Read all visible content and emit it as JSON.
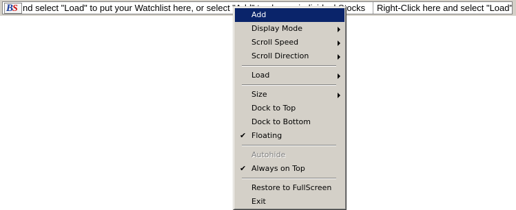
{
  "ticker": {
    "logo": {
      "b": "B",
      "s": "S"
    },
    "scroll_text": "nd select \"Load\" to put your Watchlist here, or select \"Add\" to choose individual Stocks",
    "scroll_text_2": "Right-Click here and select \"Load\" "
  },
  "menu": {
    "items": [
      {
        "label": "Add",
        "highlighted": true
      },
      {
        "label": "Display Mode",
        "submenu": true
      },
      {
        "label": "Scroll Speed",
        "submenu": true
      },
      {
        "label": "Scroll Direction",
        "submenu": true
      },
      {
        "label": "Load",
        "submenu": true
      },
      {
        "label": "Size",
        "submenu": true
      },
      {
        "label": "Dock to Top"
      },
      {
        "label": "Dock to Bottom"
      },
      {
        "label": "Floating",
        "checked": true
      },
      {
        "label": "Autohide",
        "disabled": true
      },
      {
        "label": "Always on Top",
        "checked": true
      },
      {
        "label": "Restore to FullScreen"
      },
      {
        "label": "Exit"
      }
    ],
    "check_glyph": "✔"
  }
}
